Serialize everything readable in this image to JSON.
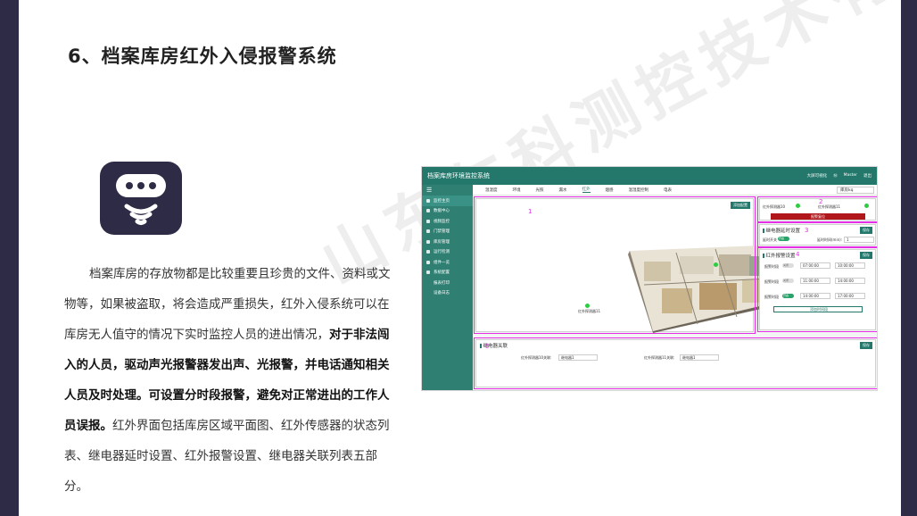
{
  "slide": {
    "title": "6、档案库房红外入侵报警系统",
    "watermark": "山东仁科测控技术有限公司",
    "paragraph_plain_1": "档案库房的存放物都是比较重要且珍贵的文件、资料或文物等，如果被盗取，将会造成严重损失，红外入侵系统可以在库房无人值守的情况下实时监控人员的进出情况，",
    "paragraph_bold": "对于非法闯入的人员，驱动声光报警器发出声、光报警，并电话通知相关人员及时处理。可设置分时段报警，避免对正常进出的工作人员误报。",
    "paragraph_plain_2": "红外界面包括库房区域平面图、红外传感器的状态列表、继电器延时设置、红外报警设置、继电器关联列表五部分。",
    "colors": {
      "frame": "#2d2b45",
      "accent": "#24776b",
      "highlight": "#e62ee6",
      "alarm": "#b0161a"
    }
  },
  "shot": {
    "app_title": "档案库房环境监控系统",
    "top_right": [
      "大屏可视化",
      "Ⓜ",
      "Master",
      "退出"
    ],
    "menu_icon": "menu-icon",
    "sidebar": [
      {
        "label": "监控主页",
        "icon": "home-icon"
      },
      {
        "label": "数据中心",
        "icon": "data-icon"
      },
      {
        "label": "视频监控",
        "icon": "video-icon"
      },
      {
        "label": "门禁管理",
        "icon": "door-icon"
      },
      {
        "label": "库房管理",
        "icon": "user-icon"
      },
      {
        "label": "运行检测",
        "icon": "check-icon"
      },
      {
        "label": "组件一览",
        "icon": "list-icon"
      },
      {
        "label": "系统配置",
        "icon": "gear-icon"
      },
      {
        "label": "报表打印",
        "icon": ""
      },
      {
        "label": "设备日志",
        "icon": ""
      }
    ],
    "tabs": [
      "温湿度",
      "环境",
      "光照",
      "漏水",
      "红外",
      "烟感",
      "温湿度控制",
      "电表"
    ],
    "active_tab": "红外",
    "room_select": "库房kq",
    "panel1": {
      "num": "1",
      "button": "添加配置",
      "sensor_label": "红外探测器11"
    },
    "panel2": {
      "num": "2",
      "sensors": [
        "红外探测器10",
        "红外探测器11"
      ],
      "alarm_button": "报警复位"
    },
    "panel3": {
      "num": "3",
      "title": "继电器延时设置",
      "save": "保存",
      "enable_label": "延时开关",
      "toggle": "开启",
      "time_label": "延时时间(min):",
      "time_value": "1"
    },
    "panel4": {
      "num": "4",
      "title": "红外报警设置",
      "save": "保存",
      "rows": [
        {
          "label": "报警时段",
          "toggle": "关闭",
          "start": "07:00:00",
          "end": "10:00:00"
        },
        {
          "label": "报警时段",
          "toggle": "关闭",
          "start": "11:00:00",
          "end": "14:00:00"
        },
        {
          "label": "报警时段",
          "toggle": "开启",
          "start": "14:00:00",
          "end": "17:00:00"
        }
      ],
      "add_button": "添加时间段"
    },
    "panel5": {
      "num": "5",
      "title": "继电器关联",
      "save": "保存",
      "relations": [
        {
          "label": "红外探测器10关联:",
          "value": "继电器1"
        },
        {
          "label": "红外探测器11关联:",
          "value": "继电器1"
        }
      ]
    }
  }
}
